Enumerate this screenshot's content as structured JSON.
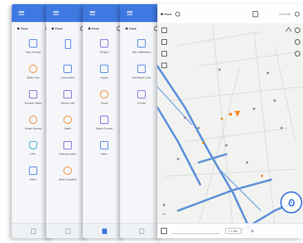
{
  "status": {
    "fix_label": "Fixed",
    "sub": "0.01"
  },
  "panel1": {
    "items": [
      {
        "label": "Topo Survey",
        "icon": "topo-survey-icon",
        "color": "blue"
      },
      {
        "label": "Stake Line",
        "icon": "stake-line-icon",
        "color": "orange"
      },
      {
        "label": "Surface Stake",
        "icon": "surface-stake-icon",
        "color": "purple"
      },
      {
        "label": "Smart Survey",
        "icon": "smart-survey-icon",
        "color": "orange"
      },
      {
        "label": "PPK",
        "icon": "ppk-icon",
        "color": "cyan"
      },
      {
        "label": "More",
        "icon": "more-icon",
        "color": "blue"
      }
    ]
  },
  "panel2": {
    "items": [
      {
        "label": "",
        "icon": "device-icon",
        "color": "phone"
      },
      {
        "label": "Connection",
        "icon": "connection-icon",
        "color": "blue"
      },
      {
        "label": "Device info",
        "icon": "device-info-icon",
        "color": "purple"
      },
      {
        "label": "Static",
        "icon": "static-icon",
        "color": "orange"
      },
      {
        "label": "External radio",
        "icon": "external-radio-icon",
        "color": "purple"
      },
      {
        "label": "Mesh Location",
        "icon": "mesh-location-icon",
        "color": "orange"
      }
    ]
  },
  "panel3": {
    "items": [
      {
        "label": "Project",
        "icon": "project-icon",
        "color": "purple"
      },
      {
        "label": "Import",
        "icon": "import-icon",
        "color": "blue"
      },
      {
        "label": "Cloud",
        "icon": "cloud-icon",
        "color": "orange"
      },
      {
        "label": "Stake Coords",
        "icon": "stake-coords-icon",
        "color": "purple"
      },
      {
        "label": "More",
        "icon": "more-icon",
        "color": "blue"
      }
    ]
  },
  "panel4": {
    "items": [
      {
        "label": "Site Calibration",
        "icon": "site-calibration-icon",
        "color": "blue"
      },
      {
        "label": "Earthwork Calc",
        "icon": "earthwork-icon",
        "color": "blue"
      },
      {
        "label": "E-mail",
        "icon": "email-icon",
        "color": "purple"
      }
    ]
  },
  "map": {
    "top_right": "0.01 0.02",
    "zoom_in": "+",
    "zoom_out": "−",
    "bottom_unit": "T 1.500",
    "bottom_action": "+"
  },
  "colors": {
    "accent": "#3f78e0",
    "road": "#5b8fd9",
    "marker": "#f08a24"
  }
}
